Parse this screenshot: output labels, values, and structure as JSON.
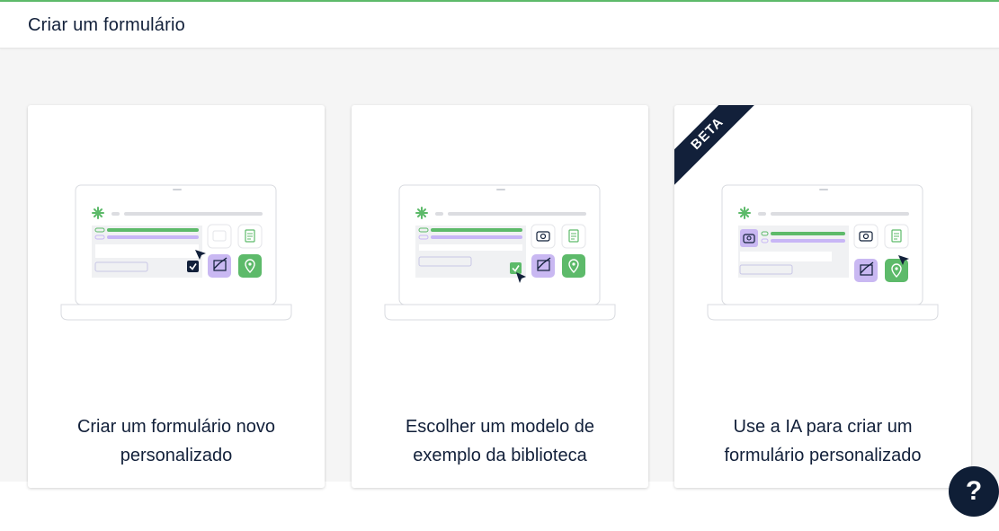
{
  "header": {
    "title": "Criar um formulário"
  },
  "cards": [
    {
      "label": "Criar um formulário novo personalizado",
      "illustration": "laptop-form-icon"
    },
    {
      "label": "Escolher um modelo de exemplo da biblioteca",
      "illustration": "laptop-form-icon"
    },
    {
      "label": "Use a IA para criar um formulário personalizado",
      "illustration": "laptop-form-icon",
      "badge": "BETA"
    }
  ],
  "help": {
    "icon": "help-icon",
    "label": "?"
  },
  "colors": {
    "navy": "#12203a",
    "green": "#5dba6a",
    "purple": "#c9b8f2",
    "lavender_line": "#c8b6f6"
  }
}
